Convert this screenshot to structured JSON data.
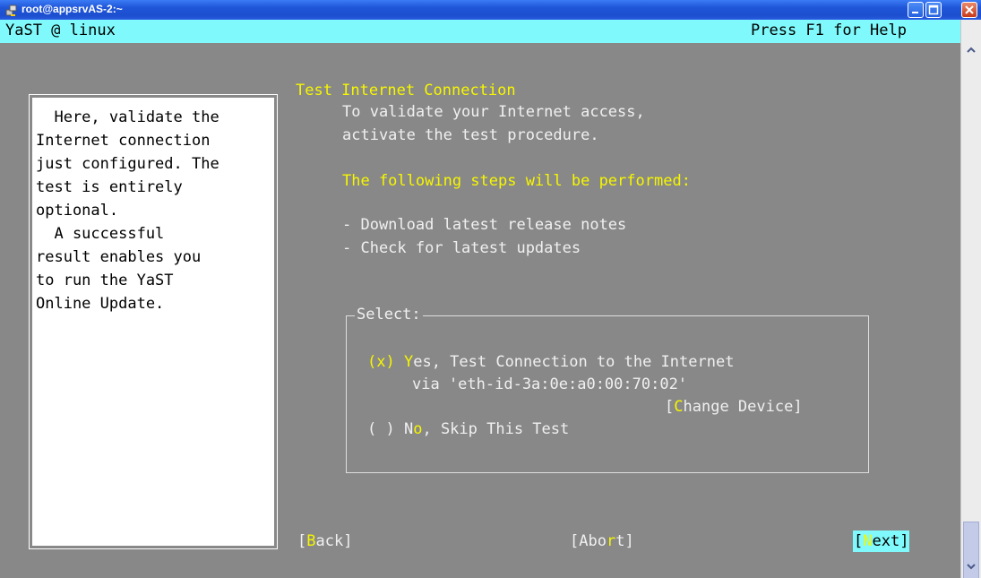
{
  "window": {
    "title": "root@appsrvAS-2:~"
  },
  "topbar": {
    "left": "YaST @ linux",
    "right": "Press F1 for Help"
  },
  "help": {
    "lines": [
      "  Here, validate the",
      "Internet connection",
      "just configured. The",
      "test is entirely",
      "optional.",
      "  A successful",
      "result enables you",
      "to run the YaST",
      "Online Update."
    ]
  },
  "main": {
    "heading": "Test Internet Connection",
    "intro1": "To validate your Internet access,",
    "intro2": "activate the test procedure.",
    "steps_heading": "The following steps will be performed:",
    "steps": [
      "- Download latest release notes",
      "- Check for latest updates"
    ]
  },
  "select": {
    "label": "Select:",
    "yes_marker": "(x)",
    "yes_hotkey": "Y",
    "yes_rest": "es, Test Connection to the Internet",
    "yes_line2": "via 'eth-id-3a:0e:a0:00:70:02'",
    "change_open": "[",
    "change_hotkey": "C",
    "change_rest": "hange Device]",
    "no_marker": "( )",
    "no_N": "N",
    "no_o": "o",
    "no_rest": ", Skip This Test"
  },
  "buttons": {
    "back_open": "[",
    "back_hotkey": "B",
    "back_rest": "ack]",
    "abort_before": "[Abo",
    "abort_hotkey": "r",
    "abort_after": "t]",
    "next_open": "[",
    "next_hotkey": "N",
    "next_rest": "ext]"
  }
}
